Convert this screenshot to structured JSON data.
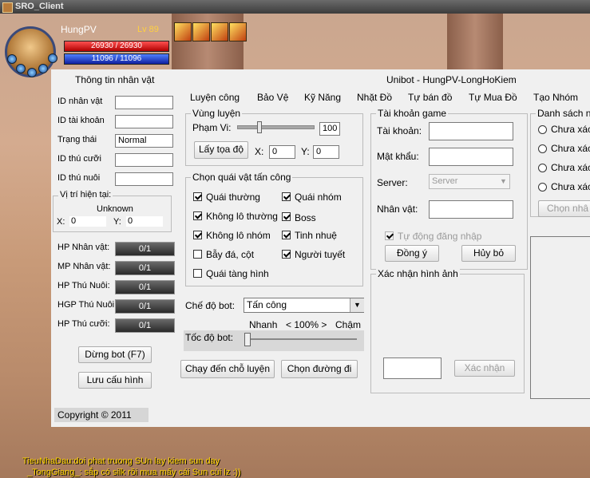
{
  "window": {
    "title": "SRO_Client"
  },
  "character": {
    "name": "HungPV",
    "level": "Lv 89",
    "hp": "26930 / 26930",
    "mp": "11096 / 11096"
  },
  "panel": {
    "left_title": "Thông tin nhân vật",
    "main_title": "Unibot - HungPV-LongHoKiem",
    "menu": [
      "Luyện công",
      "Bảo Vệ",
      "Kỹ Năng",
      "Nhặt Đồ",
      "Tự bán đồ",
      "Tự Mua Đồ",
      "Tạo Nhóm"
    ],
    "info_fields": [
      {
        "label": "ID nhân vật",
        "value": ""
      },
      {
        "label": "ID tài khoản",
        "value": ""
      },
      {
        "label": "Trạng thái",
        "value": "Normal"
      },
      {
        "label": "ID thú cưỡi",
        "value": ""
      },
      {
        "label": "ID thú nuôi",
        "value": ""
      }
    ],
    "position": {
      "caption": "Vị trí hiện tại:",
      "map": "Unknown",
      "x_label": "X:",
      "x_value": "0",
      "y_label": "Y:",
      "y_value": "0"
    },
    "bars": [
      {
        "label": "HP Nhân vật:",
        "value": "0/1"
      },
      {
        "label": "MP Nhân vật:",
        "value": "0/1"
      },
      {
        "label": "HP Thú Nuôi:",
        "value": "0/1"
      },
      {
        "label": "HGP Thú Nuôi:",
        "value": "0/1"
      },
      {
        "label": "HP Thú cưỡi:",
        "value": "0/1"
      }
    ],
    "stop_bot": "Dừng bot (F7)",
    "save_config": "Lưu cấu hình",
    "copyright": "Copyright © 2011",
    "zone": {
      "caption": "Vùng luyện",
      "range_label": "Phạm Vi:",
      "range_value": "100",
      "get_coords": "Lấy tọa độ",
      "x_label": "X:",
      "x_value": "0",
      "y_label": "Y:",
      "y_value": "0"
    },
    "monsters": {
      "caption": "Chọn quái vật tấn công",
      "items": [
        {
          "label": "Quái thường",
          "checked": true
        },
        {
          "label": "Quái nhóm",
          "checked": true
        },
        {
          "label": "Không lô thường",
          "checked": true
        },
        {
          "label": "Boss",
          "checked": true
        },
        {
          "label": "Không lô nhóm",
          "checked": true
        },
        {
          "label": "Tinh nhuệ",
          "checked": true
        },
        {
          "label": "Bẫy đá, cột",
          "checked": false
        },
        {
          "label": "Người tuyết",
          "checked": true
        },
        {
          "label": "Quái tàng hình",
          "checked": false
        }
      ]
    },
    "bot_mode": {
      "label": "Chế độ bot:",
      "value": "Tấn công"
    },
    "bot_speed": {
      "fast": "Nhanh",
      "pct": "< 100% >",
      "slow": "Chậm",
      "label": "Tốc độ bot:"
    },
    "go_train": "Chạy đến chỗ luyện",
    "choose_path": "Chọn đường đi",
    "account": {
      "caption": "Tài khoản game",
      "account_label": "Tài khoản:",
      "password_label": "Mật khẩu:",
      "server_label": "Server:",
      "server_placeholder": "Server",
      "char_label": "Nhân vật:",
      "auto_login": "Tự động đăng nhập",
      "ok": "Đồng ý",
      "cancel": "Hủy bỏ"
    },
    "captcha": {
      "caption": "Xác nhận hình ảnh",
      "confirm": "Xác nhận"
    },
    "list": {
      "caption": "Danh sách n",
      "options": [
        "Chưa xác",
        "Chưa xác",
        "Chưa xác",
        "Chưa xác"
      ],
      "choose": "Chọn nhâ"
    }
  },
  "chat": [
    "TieuNhaDau:doi phat truong SUn lay kiem sun day",
    "_TongGiang_: sắp có silk rồi mua mấy cái Sun cùi lz :))"
  ]
}
